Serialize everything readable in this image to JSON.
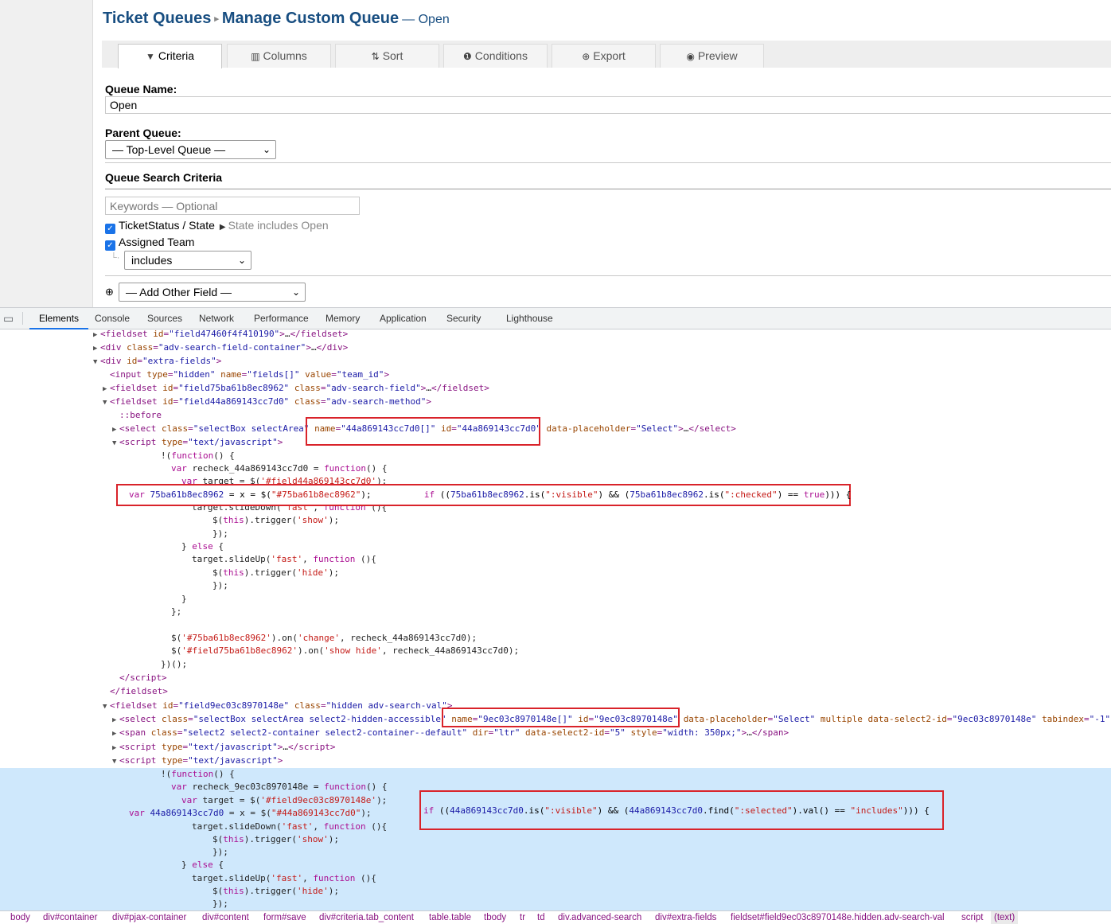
{
  "header": {
    "title": "Ticket Queues",
    "separator": "▸",
    "subtitle": "Manage Custom Queue",
    "subtitle_suffix": "— Open"
  },
  "tabs": [
    {
      "icon": "filter-icon",
      "glyph": "▼",
      "label": "Criteria",
      "active": true
    },
    {
      "icon": "columns-icon",
      "glyph": "▥",
      "label": "Columns"
    },
    {
      "icon": "sort-icon",
      "glyph": "⇅",
      "label": "Sort"
    },
    {
      "icon": "info-icon",
      "glyph": "❶",
      "label": "Conditions"
    },
    {
      "icon": "export-icon",
      "glyph": "⊕",
      "label": "Export"
    },
    {
      "icon": "eye-icon",
      "glyph": "◉",
      "label": "Preview"
    }
  ],
  "form": {
    "queue_name_label": "Queue Name:",
    "queue_name_value": "Open",
    "parent_queue_label": "Parent Queue:",
    "parent_queue_value": "— Top-Level Queue —",
    "search_criteria_label": "Queue Search Criteria",
    "keywords_placeholder": "Keywords — Optional",
    "status_label": "TicketStatus / State",
    "status_summary": "State includes Open",
    "team_label": "Assigned Team",
    "team_method_value": "includes",
    "add_field_value": "— Add Other Field —"
  },
  "devtools": {
    "tabs": [
      "Elements",
      "Console",
      "Sources",
      "Network",
      "Performance",
      "Memory",
      "Application",
      "Security",
      "Lighthouse"
    ],
    "active_tab": "Elements",
    "breadcrumbs": [
      "body",
      "div#container",
      "div#pjax-container",
      "div#content",
      "form#save",
      "div#criteria.tab_content",
      "table.table",
      "tbody",
      "tr",
      "td",
      "div.advanced-search",
      "div#extra-fields",
      "fieldset#field9ec03c8970148e.hidden.adv-search-val",
      "script",
      "(text)"
    ]
  },
  "colors": {
    "title": "#184e81",
    "highlight": "#cfe8fc",
    "annotation": "#d9232a",
    "tag": "#881280",
    "attr_name": "#994500",
    "attr_value": "#1a1aa6"
  }
}
